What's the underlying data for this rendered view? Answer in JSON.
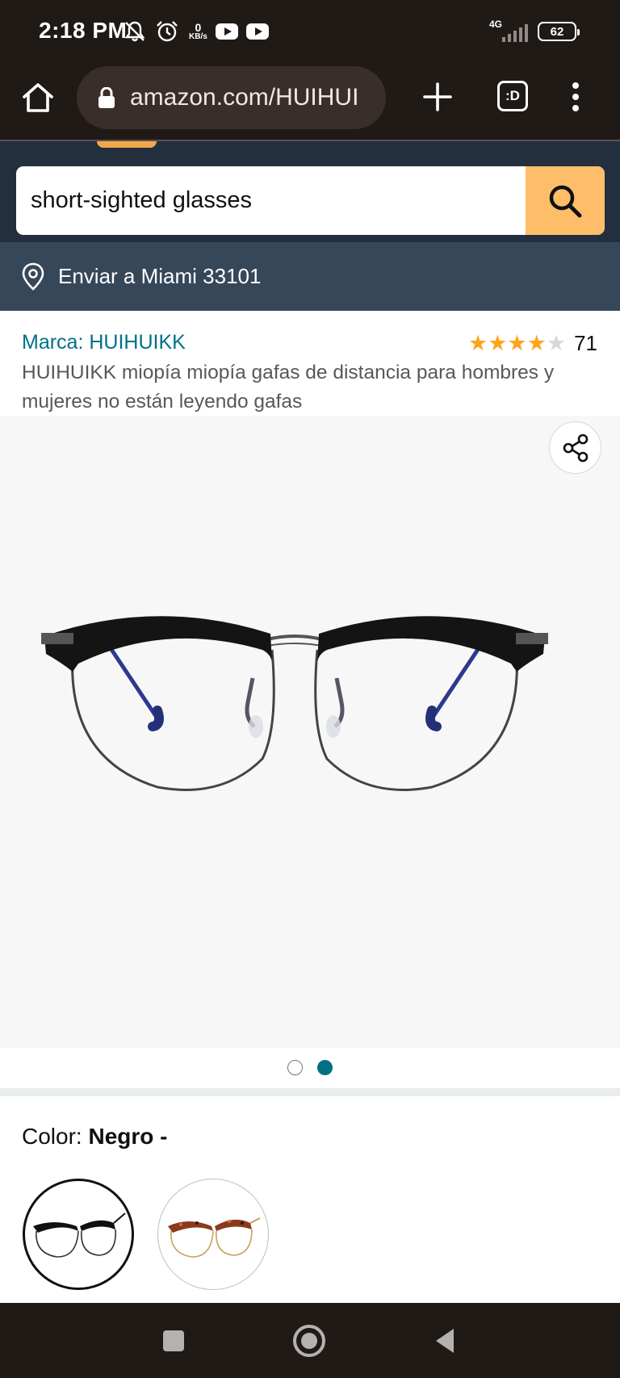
{
  "status_bar": {
    "time": "2:18 PM",
    "speed_value": "0",
    "speed_unit": "KB/s",
    "network": "4G",
    "battery": "62",
    "icons": [
      "mute-icon",
      "alarm-icon",
      "youtube-icon",
      "youtube-icon"
    ]
  },
  "browser": {
    "url": "amazon.com/HUIHUI",
    "tabs_label": ":D"
  },
  "search": {
    "query": "short-sighted glasses"
  },
  "delivery": {
    "text": "Enviar a Miami 33101"
  },
  "product": {
    "brand": "Marca: HUIHUIKK",
    "rating": 4,
    "rating_max": 5,
    "rating_count": "71",
    "title": "HUIHUIKK miopía miopía gafas de distancia para hombres y mujeres no están leyendo gafas",
    "images_total": 2,
    "image_index": 2
  },
  "color": {
    "label": "Color:",
    "value": "Negro -",
    "swatches": [
      "Negro",
      "Carey"
    ]
  },
  "colors": {
    "amazon_navy": "#232f3e",
    "deliver_bar": "#37475a",
    "search_button": "#febd69",
    "link_teal": "#007185",
    "star": "#ffa41c",
    "system_bar": "#201a17"
  }
}
